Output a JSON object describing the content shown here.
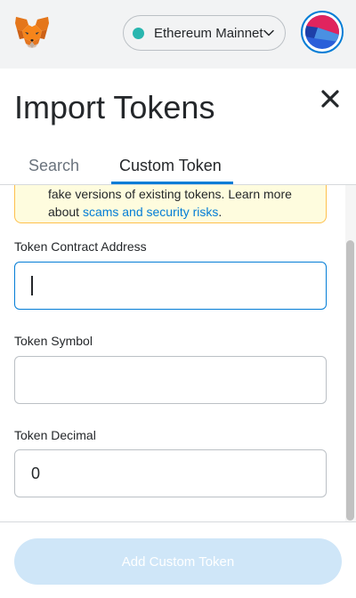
{
  "header": {
    "network_label": "Ethereum Mainnet",
    "network_dot_color": "#29b6af",
    "icons": {
      "logo": "metamask-fox-icon",
      "chevron": "chevron-down-icon",
      "account": "account-avatar"
    }
  },
  "page": {
    "title": "Import Tokens",
    "close_icon": "close-icon"
  },
  "tabs": [
    {
      "label": "Search",
      "active": false
    },
    {
      "label": "Custom Token",
      "active": true
    }
  ],
  "warning": {
    "text_partial": "fake versions of existing tokens. Learn more about ",
    "link_text": "scams and security risks",
    "text_end": "."
  },
  "form": {
    "contract_address": {
      "label": "Token Contract Address",
      "value": ""
    },
    "symbol": {
      "label": "Token Symbol",
      "value": ""
    },
    "decimal": {
      "label": "Token Decimal",
      "value": "0"
    }
  },
  "footer": {
    "add_button_label": "Add Custom Token",
    "add_button_disabled": true
  },
  "colors": {
    "accent": "#037dd6",
    "warning_bg": "#fefcde",
    "warning_border": "#fec04c",
    "disabled_button": "#cfe6f8"
  }
}
